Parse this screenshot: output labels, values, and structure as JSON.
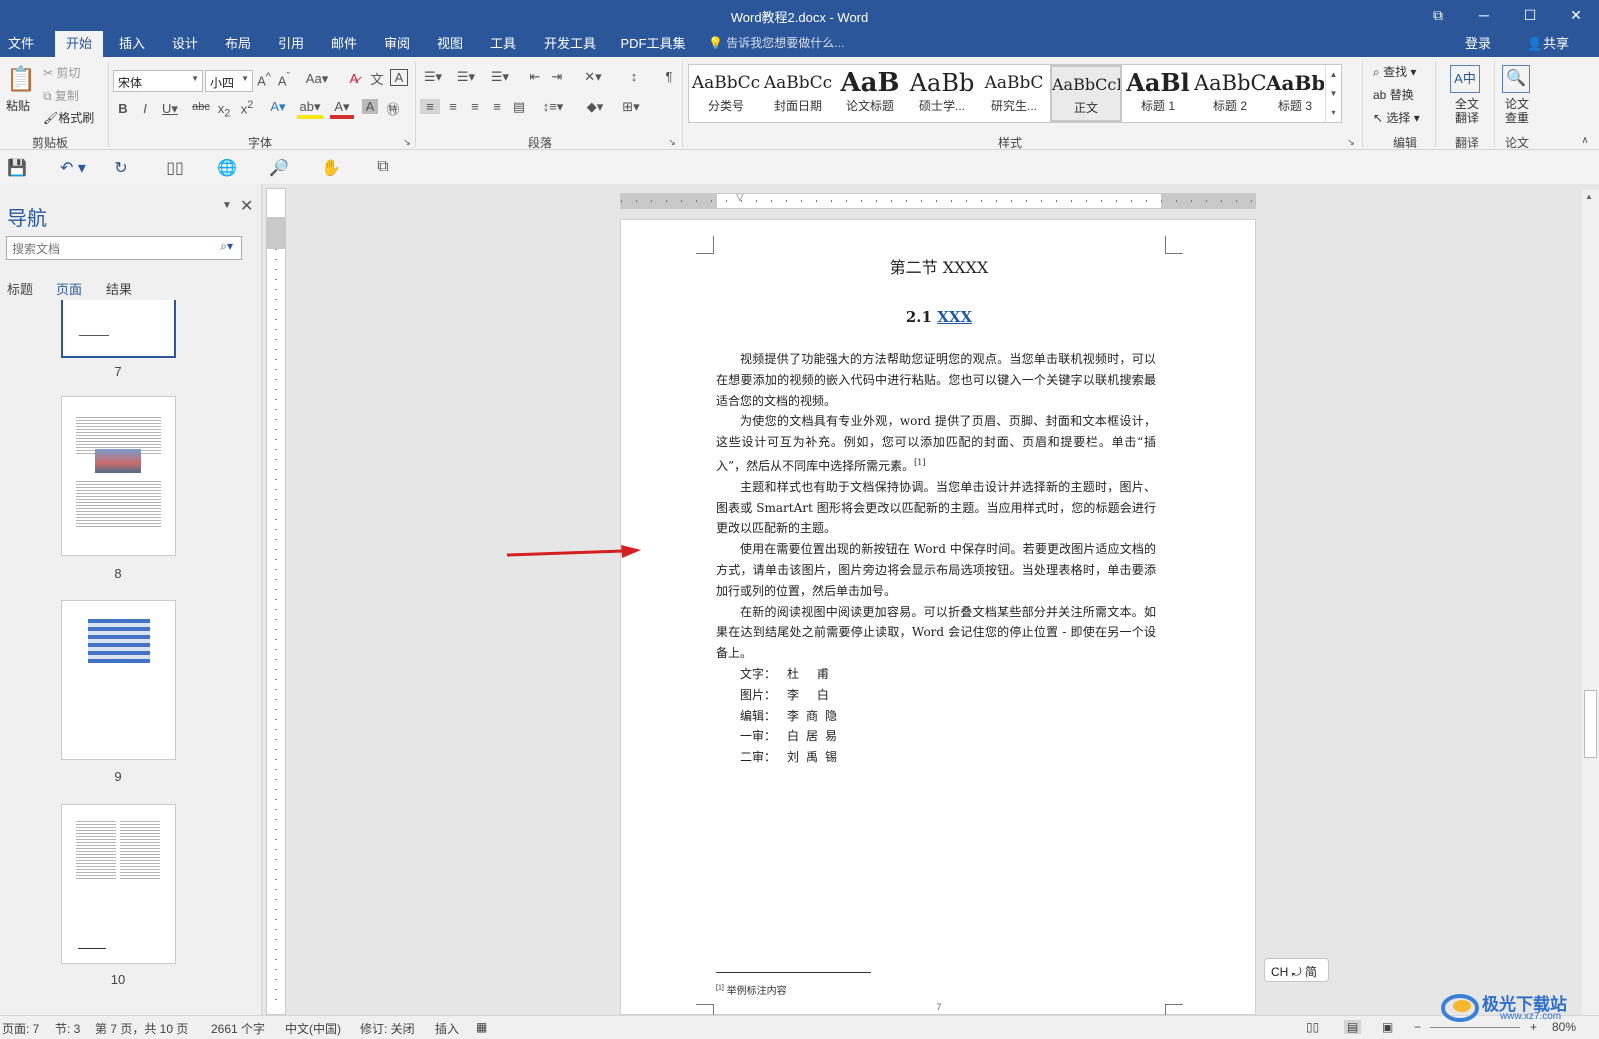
{
  "window": {
    "title": "Word教程2.docx - Word"
  },
  "tabs": [
    "文件",
    "开始",
    "插入",
    "设计",
    "布局",
    "引用",
    "邮件",
    "审阅",
    "视图",
    "工具",
    "开发工具",
    "PDF工具集"
  ],
  "tell_me": "告诉我您想要做什么...",
  "login": "登录",
  "share": "共享",
  "clipboard": {
    "paste": "粘贴",
    "cut": "剪切",
    "copy": "复制",
    "format_painter": "格式刷",
    "label": "剪贴板"
  },
  "font": {
    "name": "宋体",
    "size": "小四",
    "label": "字体",
    "aa": "Aa"
  },
  "paragraph": {
    "label": "段落"
  },
  "styles": {
    "label": "样式",
    "items": [
      {
        "sample": "AaBbCc",
        "name": "分类号"
      },
      {
        "sample": "AaBbCc",
        "name": "封面日期"
      },
      {
        "sample": "AaB",
        "name": "论文标题"
      },
      {
        "sample": "AaBb",
        "name": "硕士学..."
      },
      {
        "sample": "AaBbC",
        "name": "研究生..."
      },
      {
        "sample": "AaBbCcI",
        "name": "正文"
      },
      {
        "sample": "AaBl",
        "name": "标题 1"
      },
      {
        "sample": "AaBbC",
        "name": "标题 2"
      },
      {
        "sample": "AaBb",
        "name": "标题 3"
      }
    ]
  },
  "editing": {
    "find": "查找",
    "replace": "替换",
    "select": "选择",
    "label": "编辑"
  },
  "translate": {
    "full": "全文翻译",
    "label": "翻译"
  },
  "paper": {
    "check": "论文查重",
    "label": "论文"
  },
  "nav": {
    "title": "导航",
    "search_placeholder": "搜索文档",
    "tabs": [
      "标题",
      "页面",
      "结果"
    ],
    "pages": [
      "7",
      "8",
      "9",
      "10"
    ]
  },
  "document": {
    "section_title": "第二节  XXXX",
    "sub_num": "2.1 ",
    "sub_link": "XXX",
    "paragraphs": [
      "视频提供了功能强大的方法帮助您证明您的观点。当您单击联机视频时，可以在想要添加的视频的嵌入代码中进行粘贴。您也可以键入一个关键字以联机搜索最适合您的文档的视频。",
      "为使您的文档具有专业外观，word 提供了页眉、页脚、封面和文本框设计，这些设计可互为补充。例如，您可以添加匹配的封面、页眉和提要栏。单击“插入”，然后从不同库中选择所需元素。",
      "主题和样式也有助于文档保持协调。当您单击设计并选择新的主题时，图片、图表或 SmartArt 图形将会更改以匹配新的主题。当应用样式时，您的标题会进行更改以匹配新的主题。",
      "使用在需要位置出现的新按钮在 Word 中保存时间。若要更改图片适应文档的方式，请单击该图片，图片旁边将会显示布局选项按钮。当处理表格时，单击要添加行或列的位置，然后单击加号。",
      "在新的阅读视图中阅读更加容易。可以折叠文档某些部分并关注所需文本。如果在达到结尾处之前需要停止读取，Word 会记住您的停止位置 - 即使在另一个设备上。"
    ],
    "footnote_ref": "[1]",
    "credits": [
      {
        "k": "文字：",
        "v": "杜  甫"
      },
      {
        "k": "图片：",
        "v": "李  白"
      },
      {
        "k": "编辑：",
        "v": "李商隐"
      },
      {
        "k": "一审：",
        "v": "白居易"
      },
      {
        "k": "二审：",
        "v": "刘禹锡"
      }
    ],
    "footnote": "举例标注内容",
    "page_number": "7"
  },
  "ime_badge": "CH ⤾ 简",
  "status": {
    "page": "页面: 7",
    "section": "节: 3",
    "page_of": "第 7 页，共 10 页",
    "words": "2661 个字",
    "lang": "中文(中国)",
    "revision": "修订: 关闭",
    "insert": "插入",
    "zoom": "80%"
  },
  "watermark": {
    "text": "极光下载站",
    "url": "www.xz7.com"
  }
}
